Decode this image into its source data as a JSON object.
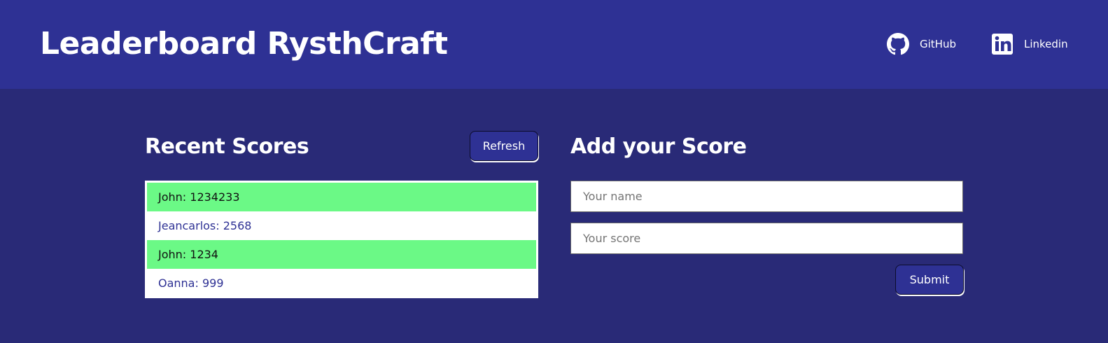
{
  "header": {
    "title": "Leaderboard RysthCraft",
    "links": [
      {
        "label": "GitHub",
        "icon": "github-icon"
      },
      {
        "label": "Linkedin",
        "icon": "linkedin-icon"
      }
    ]
  },
  "recent": {
    "title": "Recent Scores",
    "refresh_label": "Refresh",
    "scores": [
      {
        "text": "John: 1234233",
        "highlight": true
      },
      {
        "text": "Jeancarlos: 2568",
        "highlight": false
      },
      {
        "text": "John: 1234",
        "highlight": true
      },
      {
        "text": "Oanna: 999",
        "highlight": false
      }
    ]
  },
  "add": {
    "title": "Add your Score",
    "name_placeholder": "Your name",
    "name_value": "",
    "score_placeholder": "Your score",
    "score_value": "",
    "submit_label": "Submit"
  },
  "colors": {
    "header_bg": "#2e3194",
    "page_bg": "#292a77",
    "highlight_row": "#6bf986",
    "text_on_dark": "#ffffff"
  }
}
